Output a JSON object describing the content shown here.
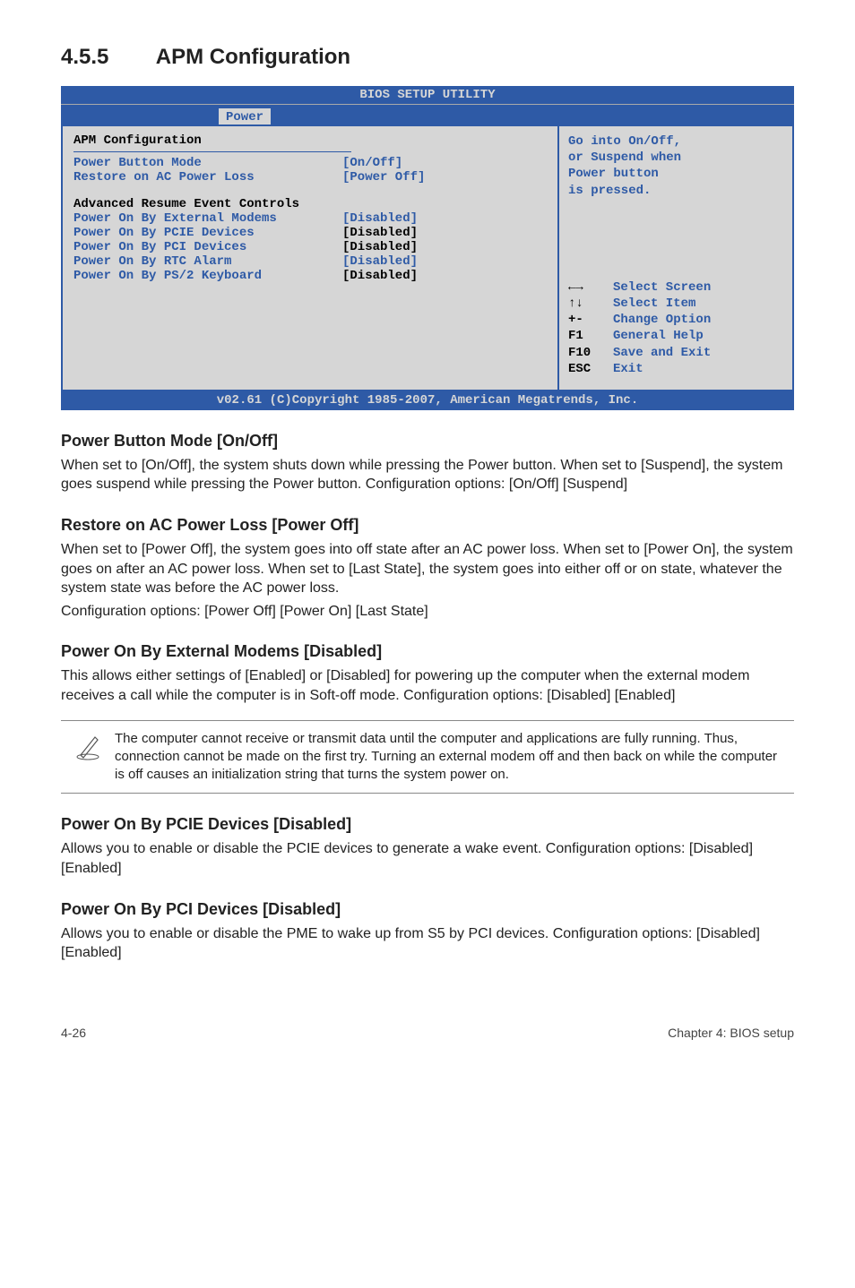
{
  "heading": {
    "number": "4.5.5",
    "title": "APM Configuration"
  },
  "bios": {
    "headerTitle": "BIOS SETUP UTILITY",
    "activeTab": "Power",
    "sectionTitle": "APM Configuration",
    "groupTitle": "Advanced Resume Event Controls",
    "settings": {
      "powerButtonMode": {
        "label": "Power Button Mode",
        "value": "[On/Off]"
      },
      "restoreAcLoss": {
        "label": "Restore on AC Power Loss",
        "value": "[Power Off]"
      },
      "extModems": {
        "label": "Power On By External Modems",
        "value": "[Disabled]"
      },
      "pcieDevices": {
        "label": "Power On By PCIE Devices",
        "value": "[Disabled]"
      },
      "pciDevices": {
        "label": "Power On By PCI Devices",
        "value": "[Disabled]"
      },
      "rtcAlarm": {
        "label": "Power On By RTC Alarm",
        "value": "[Disabled]"
      },
      "ps2Keyboard": {
        "label": "Power On By PS/2 Keyboard",
        "value": "[Disabled]"
      }
    },
    "help": {
      "line1": "Go into On/Off,",
      "line2": "or Suspend when",
      "line3": "Power button",
      "line4": "is pressed."
    },
    "legend": {
      "arrows": {
        "key": "←→",
        "action": "Select Screen"
      },
      "updown": {
        "key": "↑↓",
        "action": "Select Item"
      },
      "plusmin": {
        "key": "+-",
        "action": "Change Option"
      },
      "f1": {
        "key": "F1",
        "action": "General Help"
      },
      "f10": {
        "key": "F10",
        "action": "Save and Exit"
      },
      "esc": {
        "key": "ESC",
        "action": "Exit"
      }
    },
    "footer": "v02.61 (C)Copyright 1985-2007, American Megatrends, Inc."
  },
  "sections": {
    "s1": {
      "title": "Power Button Mode [On/Off]",
      "p1": "When set to [On/Off], the system shuts down while pressing the Power button. When set to [Suspend], the system goes suspend while pressing the Power button. Configuration options: [On/Off] [Suspend]"
    },
    "s2": {
      "title": "Restore on AC Power Loss [Power Off]",
      "p1": "When set to [Power Off], the system goes into off state after an AC power loss. When set to [Power On], the system goes on after an AC power loss. When set to [Last State], the system goes into either off or on state, whatever the system state was before the AC power loss.",
      "p2": "Configuration options: [Power Off] [Power On] [Last State]"
    },
    "s3": {
      "title": "Power On By External Modems [Disabled]",
      "p1": "This allows either settings of [Enabled] or [Disabled] for powering up the computer when the external modem receives a call while the computer is in Soft-off mode. Configuration options: [Disabled] [Enabled]"
    },
    "note": "The computer cannot receive or transmit data until the computer and applications are fully running. Thus, connection cannot be made on the first try. Turning an external modem off and then back on while the computer is off causes an initialization string that turns the system power on.",
    "s4": {
      "title": "Power On By PCIE Devices [Disabled]",
      "p1": "Allows you to enable or disable the PCIE devices to generate a wake event. Configuration options: [Disabled] [Enabled]"
    },
    "s5": {
      "title": "Power On By PCI Devices [Disabled]",
      "p1": "Allows you to enable or disable the PME to wake up from S5 by PCI devices. Configuration options: [Disabled] [Enabled]"
    }
  },
  "footer": {
    "left": "4-26",
    "right": "Chapter 4: BIOS setup"
  }
}
